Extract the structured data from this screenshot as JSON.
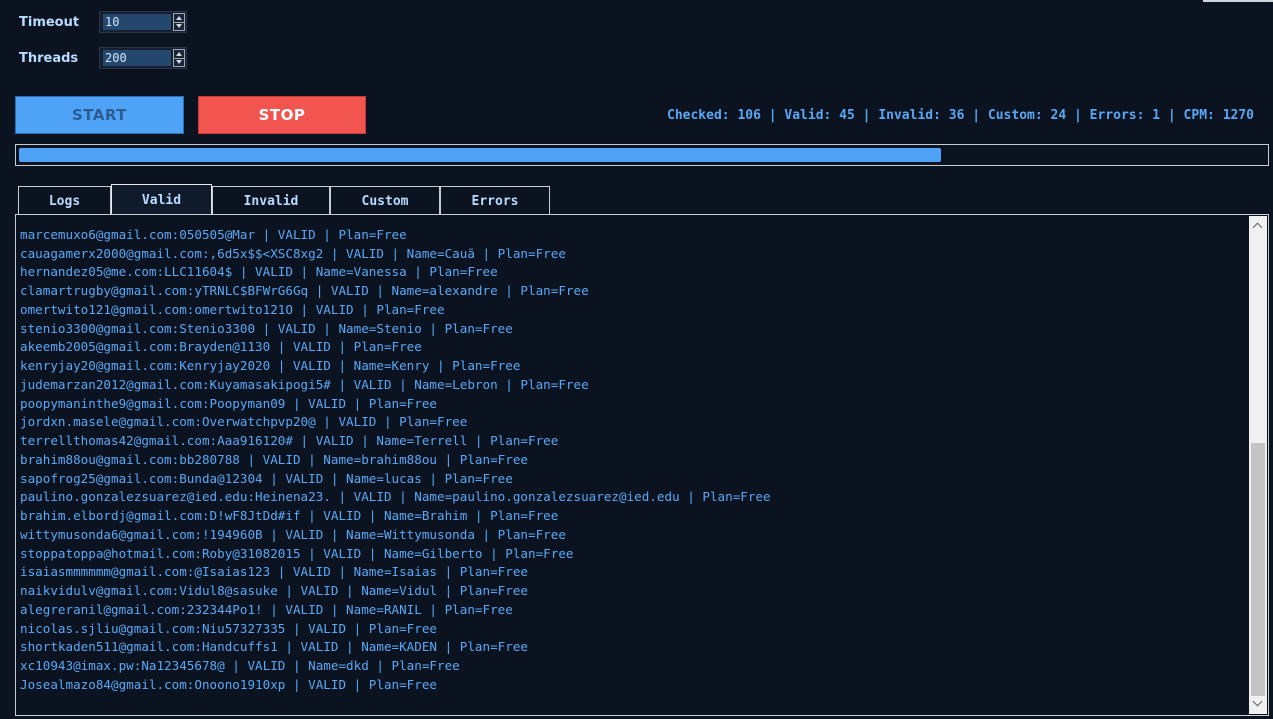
{
  "settings": {
    "timeout": {
      "label": "Timeout",
      "value": "10"
    },
    "threads": {
      "label": "Threads",
      "value": "200"
    }
  },
  "controls": {
    "start_label": "START",
    "stop_label": "STOP"
  },
  "stats": {
    "text": "Checked: 106 | Valid: 45 | Invalid: 36 | Custom: 24 | Errors: 1 | CPM: 1270"
  },
  "progress": {
    "fraction": 0.74
  },
  "tabs": [
    {
      "label": "Logs"
    },
    {
      "label": "Valid",
      "active": true
    },
    {
      "label": "Invalid"
    },
    {
      "label": "Custom"
    },
    {
      "label": "Errors"
    }
  ],
  "log": {
    "lines": [
      "marcemuxo6@gmail.com:050505@Mar | VALID | Plan=Free",
      "cauagamerx2000@gmail.com:,6d5x$$<XSC8xg2 | VALID | Name=Cauã | Plan=Free",
      "hernandez05@me.com:LLC11604$ | VALID | Name=Vanessa | Plan=Free",
      "clamartrugby@gmail.com:yTRNLC$BFWrG6Gq | VALID | Name=alexandre | Plan=Free",
      "omertwito121@gmail.com:omertwito121O | VALID | Plan=Free",
      "stenio3300@gmail.com:Stenio3300 | VALID | Name=Stenio | Plan=Free",
      "akeemb2005@gmail.com:Brayden@1130 | VALID | Plan=Free",
      "kenryjay20@gmail.com:Kenryjay2020 | VALID | Name=Kenry | Plan=Free",
      "judemarzan2012@gmail.com:Kuyamasakipogi5# | VALID | Name=Lebron | Plan=Free",
      "poopymaninthe9@gmail.com:Poopyman09 | VALID | Plan=Free",
      "jordxn.masele@gmail.com:Overwatchpvp20@ | VALID | Plan=Free",
      "terrellthomas42@gmail.com:Aaa916120# | VALID | Name=Terrell | Plan=Free",
      "brahim88ou@gmail.com:bb280788 | VALID | Name=brahim88ou | Plan=Free",
      "sapofrog25@gmail.com:Bunda@12304 | VALID | Name=lucas | Plan=Free",
      "paulino.gonzalezsuarez@ied.edu:Heinena23. | VALID | Name=paulino.gonzalezsuarez@ied.edu | Plan=Free",
      "brahim.elbordj@gmail.com:D!wF8JtDd#if | VALID | Name=Brahim | Plan=Free",
      "wittymusonda6@gmail.com:!194960B | VALID | Name=Wittymusonda | Plan=Free",
      "stoppatoppa@hotmail.com:Roby@31082015 | VALID | Name=Gilberto | Plan=Free",
      "isaiasmmmmmm@gmail.com:@Isaias123 | VALID | Name=Isaias | Plan=Free",
      "naikvidulv@gmail.com:Vidul8@sasuke | VALID | Name=Vidul | Plan=Free",
      "alegreranil@gmail.com:232344Po1! | VALID | Name=RANIL | Plan=Free",
      "nicolas.sjliu@gmail.com:Niu57327335 | VALID | Plan=Free",
      "shortkaden511@gmail.com:Handcuffs1 | VALID | Name=KADEN | Plan=Free",
      "xc10943@imax.pw:Na12345678@ | VALID | Name=dkd | Plan=Free",
      "Josealmazo84@gmail.com:Onoono1910xp | VALID | Plan=Free"
    ]
  },
  "scrollbar": {
    "position": 0.55,
    "visible_fraction": 0.55
  },
  "colors": {
    "background": "#0b1320",
    "accent_blue": "#4fa3f7",
    "stop_red": "#f25450",
    "log_text": "#5aa8f5"
  }
}
